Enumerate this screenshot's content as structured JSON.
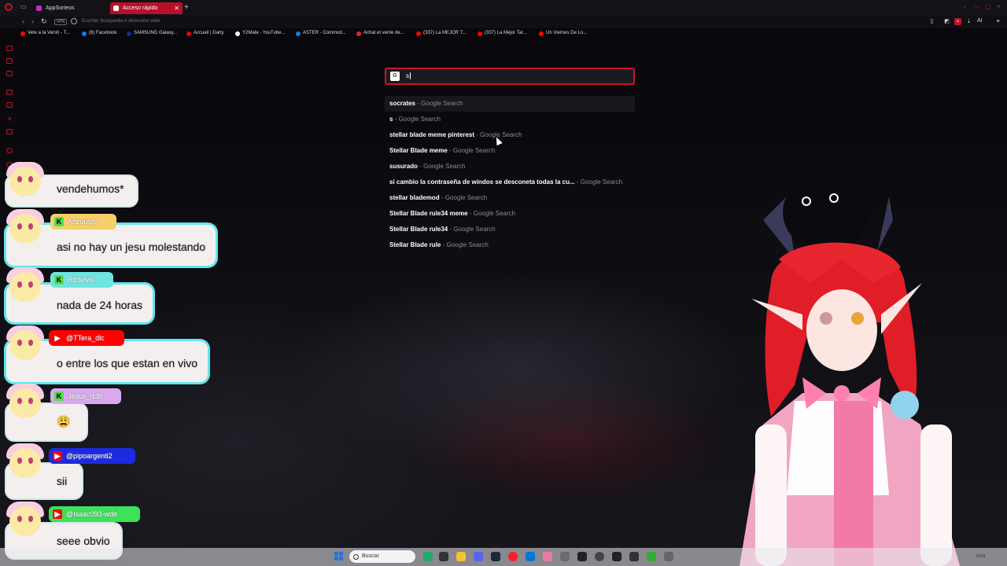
{
  "tabs": [
    {
      "label": "AppSorteos",
      "active": false
    },
    {
      "label": "Acceso rápido",
      "active": true
    }
  ],
  "address_bar": {
    "placeholder": "Escribir búsqueda o dirección web",
    "vpn": "VPN"
  },
  "toolbar": {
    "ai_label": "AI"
  },
  "bookmarks": [
    {
      "label": "Vete a la Versh - T...",
      "color": "#ff0000"
    },
    {
      "label": "(6) Facebook",
      "color": "#1877f2"
    },
    {
      "label": "SAMSUNG Galaxy...",
      "color": "#1428a0"
    },
    {
      "label": "Accueil | Darty",
      "color": "#e30613"
    },
    {
      "label": "Y2Mate - YouTube...",
      "color": "#ffffff"
    },
    {
      "label": "ASTER - Commod...",
      "color": "#2277dd"
    },
    {
      "label": "Achat et vente de...",
      "color": "#e3262d"
    },
    {
      "label": "(337) La MEJOR T...",
      "color": "#ff0000"
    },
    {
      "label": "(337) La Mejor Tar...",
      "color": "#ff0000"
    },
    {
      "label": "Un Viernes De Lo...",
      "color": "#ff0000"
    }
  ],
  "search": {
    "engine_icon": "G",
    "query": "s",
    "suggestions": [
      {
        "query": "socrates",
        "source": "- Google Search"
      },
      {
        "query": "s",
        "source": "- Google Search"
      },
      {
        "query": "stellar blade meme pinterest",
        "source": "- Google Search"
      },
      {
        "query": "Stellar Blade meme",
        "source": "- Google Search"
      },
      {
        "query": "susurado",
        "source": "- Google Search"
      },
      {
        "query": "si cambio la contraseña de windos se desconeta todas la cu...",
        "source": "- Google Search"
      },
      {
        "query": "stellar blademod",
        "source": "- Google Search"
      },
      {
        "query": "Stellar Blade rule34 meme",
        "source": "- Google Search"
      },
      {
        "query": "Stellar Blade rule34",
        "source": "- Google Search"
      },
      {
        "query": "Stellar Blade rule",
        "source": "- Google Search"
      }
    ]
  },
  "chat": [
    {
      "user": "",
      "platform": "kick",
      "message": "vendehumos*"
    },
    {
      "user": "Anzuushi",
      "platform": "kick",
      "message": "asi no hay un jesu molestando"
    },
    {
      "user": "Ritdelvis",
      "platform": "kick",
      "message": "nada de 24 horas"
    },
    {
      "user": "@TTera_dlc",
      "platform": "youtube",
      "message": "o entre los que estan en vivo"
    },
    {
      "user": "Jesus_ddb",
      "platform": "kick",
      "message": "😩"
    },
    {
      "user": "@pipoargenti2",
      "platform": "youtube",
      "message": "sii"
    },
    {
      "user": "@Isaac093-wde",
      "platform": "youtube",
      "message": "seee obvio"
    }
  ],
  "taskbar": {
    "search_label": "Buscar",
    "clock": "25/04"
  },
  "colors": {
    "accent": "#d0102c",
    "kick": "#53e24c",
    "youtube": "#ff0000",
    "bubble_border": "#5fe6ea"
  }
}
